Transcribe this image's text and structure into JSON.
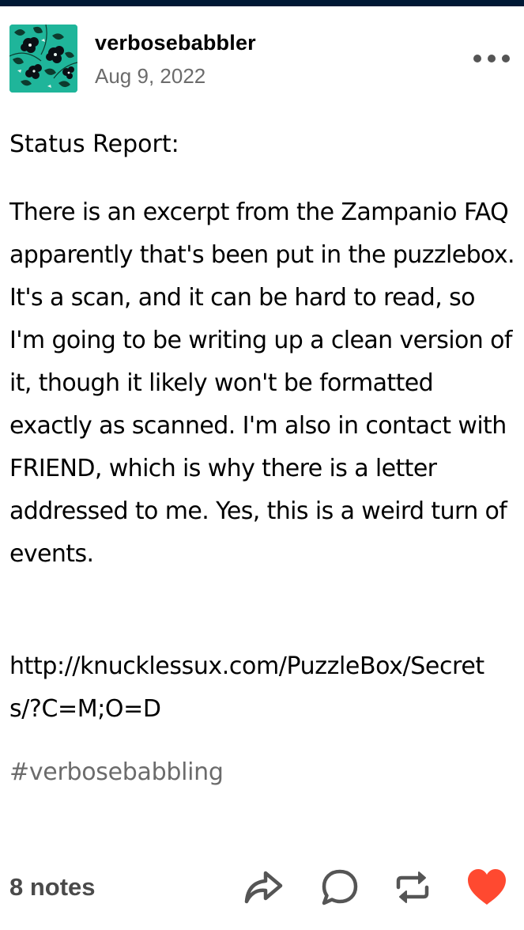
{
  "post": {
    "username": "verbosebabbler",
    "date": "Aug 9, 2022",
    "status_title": "Status Report:",
    "body": "There is an excerpt from the Zampanio FAQ apparently that's been put in the puzzlebox. It's a scan, and it can be hard to read, so I'm going to be writing up a clean version of it, though it likely won't be formatted exactly as scanned. I'm also in contact with FRIEND, which is why there is a letter addressed to me. Yes, this is a weird turn of events.",
    "link": "http://knucklessux.com/PuzzleBox/Secrets/?C=M;O=D",
    "tag": "#verbosebabbling"
  },
  "footer": {
    "notes": "8 notes",
    "icons": [
      "share-icon",
      "reply-icon",
      "reblog-icon",
      "like-icon"
    ]
  },
  "colors": {
    "topbar": "#001935",
    "muted": "#6b6b6b",
    "like": "#ff4930",
    "avatar_bg": "#1fb59a"
  }
}
